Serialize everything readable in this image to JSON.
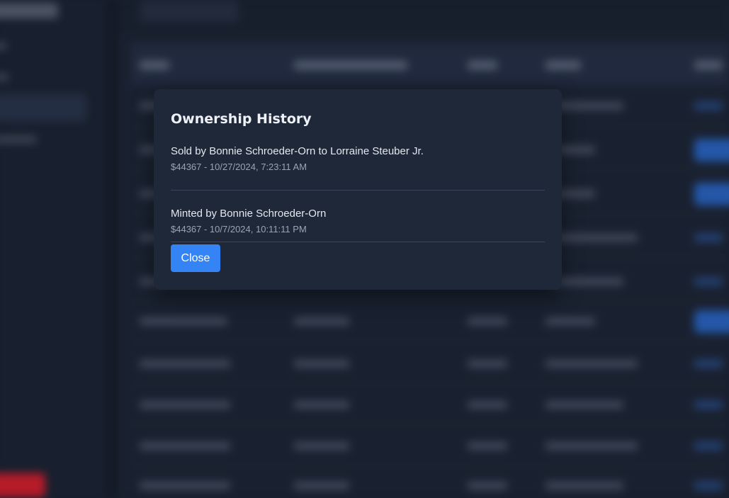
{
  "modal": {
    "title": "Ownership History",
    "history": [
      {
        "text": "Sold by Bonnie Schroeder-Orn to Lorraine Steuber Jr.",
        "meta": "$44367 - 10/27/2024, 7:23:11 AM"
      },
      {
        "text": "Minted by Bonnie Schroeder-Orn",
        "meta": "$44367 - 10/7/2024, 10:11:11 PM"
      }
    ],
    "close_label": "Close"
  },
  "colors": {
    "background": "#1e2738",
    "modal_bg": "#1f2839",
    "primary_button": "#3584f5",
    "logout_red": "#ef1f2e"
  }
}
